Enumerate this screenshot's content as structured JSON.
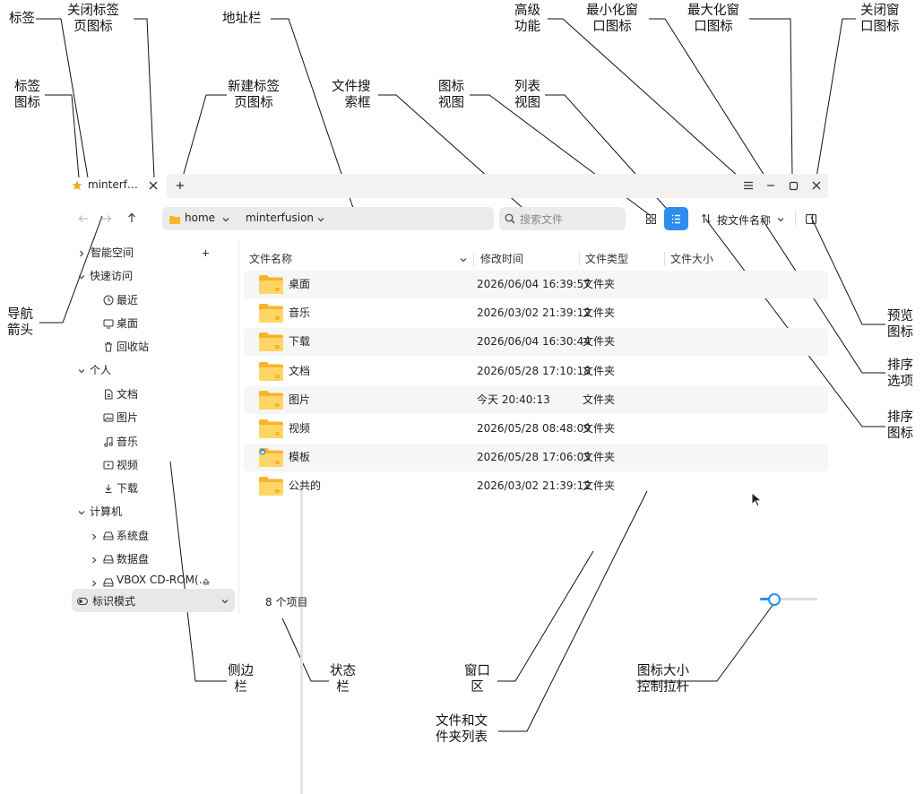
{
  "callouts": {
    "tab": "标签",
    "close_tab_icon": "关闭标签\n页图标",
    "address_bar": "地址栏",
    "advanced": "高级\n功能",
    "minimize_icon": "最小化窗\n口图标",
    "maximize_icon": "最大化窗\n口图标",
    "close_window_icon": "关闭窗\n口图标",
    "tab_icon": "标签\n图标",
    "new_tab_icon": "新建标签\n页图标",
    "file_search": "文件搜\n索框",
    "icon_view": "图标\n视图",
    "list_view": "列表\n视图",
    "nav_arrows": "导航\n箭头",
    "preview_icon": "预览\n图标",
    "sort_options": "排序\n选项",
    "sort_icon": "排序\n图标",
    "sidebar": "侧边\n栏",
    "status_bar": "状态\n栏",
    "window_area": "窗口\n区",
    "icon_size_slider": "图标大小\n控制拉杆",
    "file_list": "文件和文\n件夹列表"
  },
  "tab": {
    "label": "minterf…"
  },
  "address": {
    "segment1": "home",
    "segment2": "minterfusion"
  },
  "search": {
    "placeholder": "搜索文件"
  },
  "sort": {
    "label": "按文件名称"
  },
  "sidebar": {
    "smart_space": "智能空间",
    "quick_access": "快速访问",
    "recent": "最近",
    "desktop": "桌面",
    "trash": "回收站",
    "personal": "个人",
    "documents": "文档",
    "pictures": "图片",
    "music": "音乐",
    "videos": "视频",
    "downloads": "下载",
    "computer": "计算机",
    "system_disk": "系统盘",
    "data_disk": "数据盘",
    "cdrom": "VBOX CD-ROM(…",
    "mode": "标识模式"
  },
  "columns": {
    "name": "文件名称",
    "modified": "修改时间",
    "type": "文件类型",
    "size": "文件大小"
  },
  "files": [
    {
      "name": "桌面",
      "modified": "2026/06/04 16:39:57",
      "type": "文件夹"
    },
    {
      "name": "音乐",
      "modified": "2026/03/02 21:39:12",
      "type": "文件夹"
    },
    {
      "name": "下载",
      "modified": "2026/06/04 16:30:44",
      "type": "文件夹"
    },
    {
      "name": "文档",
      "modified": "2026/05/28 17:10:18",
      "type": "文件夹"
    },
    {
      "name": "图片",
      "modified": "今天 20:40:13",
      "type": "文件夹"
    },
    {
      "name": "视频",
      "modified": "2026/05/28 08:48:09",
      "type": "文件夹"
    },
    {
      "name": "模板",
      "modified": "2026/05/28 17:06:03",
      "type": "文件夹"
    },
    {
      "name": "公共的",
      "modified": "2026/03/02 21:39:12",
      "type": "文件夹"
    }
  ],
  "status": {
    "count": "8 个项目"
  },
  "icon_size": {
    "level": 0.25
  },
  "colors": {
    "accent": "#2d8cf0",
    "folder": "#f7b52c",
    "folder_light": "#ffd566"
  },
  "icons": {
    "tab": "star-icon",
    "close_tab": "close-icon",
    "new_tab": "plus-icon",
    "menu": "hamburger-icon",
    "minimize": "minus-icon",
    "maximize": "square-icon",
    "close_window": "close-icon",
    "back": "arrow-left-icon",
    "forward": "arrow-right-icon",
    "up": "arrow-up-icon",
    "search": "search-icon",
    "icon_view": "grid-icon",
    "list_view": "list-icon",
    "sort": "sort-icon",
    "preview": "preview-icon"
  }
}
